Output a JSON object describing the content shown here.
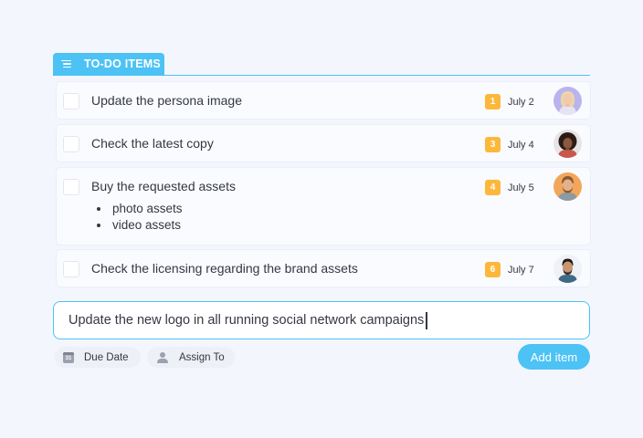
{
  "header": {
    "tab_label": "TO-DO ITEMS",
    "tab_icon": "list-icon"
  },
  "tasks": [
    {
      "text": "Update the persona image",
      "sub": [],
      "badge": "1",
      "date": "July 2",
      "avatar": "avatar-woman-blonde"
    },
    {
      "text": "Check the latest copy",
      "sub": [],
      "badge": "3",
      "date": "July 4",
      "avatar": "avatar-woman-curly"
    },
    {
      "text": "Buy the requested assets",
      "sub": [
        "photo assets",
        "video assets"
      ],
      "badge": "4",
      "date": "July 5",
      "avatar": "avatar-man-beard"
    },
    {
      "text": "Check the licensing regarding the brand assets",
      "sub": [],
      "badge": "6",
      "date": "July 7",
      "avatar": "avatar-man-dark"
    }
  ],
  "composer": {
    "value": "Update the new logo in all running social network campaigns",
    "due_label": "Due Date",
    "due_icon_day": "31",
    "assign_label": "Assign To",
    "add_label": "Add item"
  },
  "colors": {
    "accent": "#4cc2f5",
    "badge": "#fcb83b",
    "background": "#f4f6fd"
  }
}
